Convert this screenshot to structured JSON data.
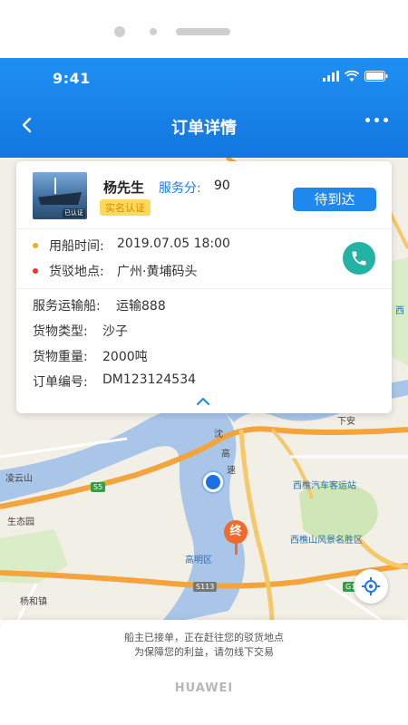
{
  "status_bar": {
    "time": "9:41"
  },
  "nav": {
    "title": "订单详情"
  },
  "map": {
    "labels": {
      "liangyun": "凌云山",
      "shengtaiyuan": "生态园",
      "yanghe": "杨和镇",
      "gaoming": "高明区",
      "xiqiao_station": "西樵汽车客运站",
      "xiqiao_scenic": "西樵山风景名胜区",
      "shen": "沈",
      "hai": "高",
      "su": "速",
      "xiaxi": "下安",
      "xi": "西"
    },
    "roads": {
      "s5": "S5",
      "s113": "S113",
      "g15": "G15"
    },
    "end_marker": "终"
  },
  "card": {
    "owner_name": "杨先生",
    "service_score_label": "服务分:",
    "service_score": "90",
    "verified_tag": "实名认证",
    "avatar_badge": "已认证",
    "status_button": "待到达",
    "rows": [
      {
        "label": "用船时间:",
        "value": "2019.07.05 18:00",
        "dot_color": "#f5a623"
      },
      {
        "label": "货驳地点:",
        "value": "广州·黄埔码头",
        "dot_color": "#e8392b"
      }
    ],
    "details": [
      {
        "label": "服务运输船:",
        "value": "运输888"
      },
      {
        "label": "货物类型:",
        "value": "沙子"
      },
      {
        "label": "货物重量:",
        "value": "2000吨"
      },
      {
        "label": "订单编号:",
        "value": "DM123124534"
      }
    ]
  },
  "bottom": {
    "notice_line1": "船主已接单，正在赶往您的驳货地点",
    "notice_line2": "为保障您的利益，请勿线下交易",
    "brand": "HUAWEI"
  }
}
